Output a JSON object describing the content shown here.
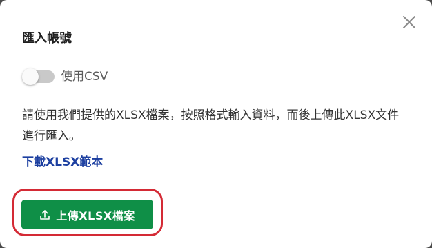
{
  "dialog": {
    "title": "匯入帳號",
    "close_icon": "close-icon",
    "csv_toggle": {
      "label": "使用CSV",
      "checked": false
    },
    "description": "請使用我們提供的XLSX檔案，按照格式輸入資料，而後上傳此XLSX文件進行匯入。",
    "download_link": "下載XLSX範本",
    "upload_button": {
      "label": "上傳XLSX檔案",
      "icon": "upload-icon"
    }
  },
  "colors": {
    "primary_button": "#0f8f47",
    "link": "#1c3fa0",
    "highlight_outline": "#d42a35",
    "toggle_track": "#c9c9c9"
  }
}
